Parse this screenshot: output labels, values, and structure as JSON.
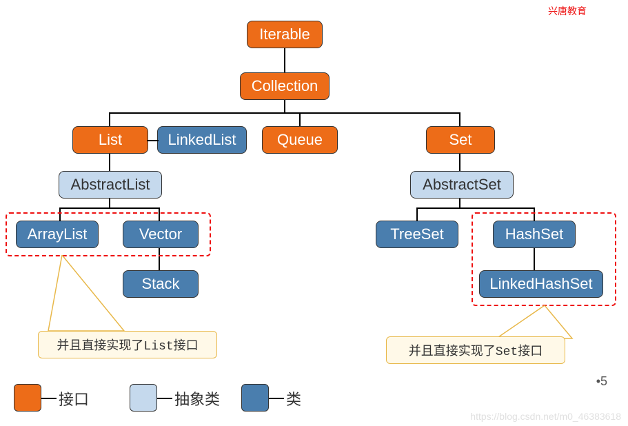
{
  "header": {
    "brand": "兴唐教育"
  },
  "nodes": {
    "iterable": "Iterable",
    "collection": "Collection",
    "list": "List",
    "linkedlist": "LinkedList",
    "queue": "Queue",
    "set": "Set",
    "abstractlist": "AbstractList",
    "abstractset": "AbstractSet",
    "arraylist": "ArrayList",
    "vector": "Vector",
    "stack": "Stack",
    "treeset": "TreeSet",
    "hashset": "HashSet",
    "linkedhashset": "LinkedHashSet"
  },
  "callouts": {
    "list_note": "并且直接实现了List接口",
    "set_note": "并且直接实现了Set接口"
  },
  "legend": {
    "interface": "接口",
    "abstract": "抽象类",
    "class": "类"
  },
  "page_number": "•5",
  "watermark": "https://blog.csdn.net/m0_46383618",
  "chart_data": {
    "type": "tree",
    "title": "Java Collection Hierarchy",
    "nodes": [
      {
        "id": "Iterable",
        "kind": "interface",
        "parent": null
      },
      {
        "id": "Collection",
        "kind": "interface",
        "parent": "Iterable"
      },
      {
        "id": "List",
        "kind": "interface",
        "parent": "Collection"
      },
      {
        "id": "Queue",
        "kind": "interface",
        "parent": "Collection"
      },
      {
        "id": "Set",
        "kind": "interface",
        "parent": "Collection"
      },
      {
        "id": "LinkedList",
        "kind": "class",
        "parent": "List"
      },
      {
        "id": "AbstractList",
        "kind": "abstract",
        "parent": "List"
      },
      {
        "id": "AbstractSet",
        "kind": "abstract",
        "parent": "Set"
      },
      {
        "id": "ArrayList",
        "kind": "class",
        "parent": "AbstractList",
        "note": "并且直接实现了List接口"
      },
      {
        "id": "Vector",
        "kind": "class",
        "parent": "AbstractList"
      },
      {
        "id": "Stack",
        "kind": "class",
        "parent": "Vector"
      },
      {
        "id": "TreeSet",
        "kind": "class",
        "parent": "AbstractSet"
      },
      {
        "id": "HashSet",
        "kind": "class",
        "parent": "AbstractSet",
        "note": "并且直接实现了Set接口"
      },
      {
        "id": "LinkedHashSet",
        "kind": "class",
        "parent": "HashSet",
        "note": "并且直接实现了Set接口"
      }
    ],
    "legend": {
      "interface": "接口",
      "abstract": "抽象类",
      "class": "类"
    },
    "highlighted_groups": [
      [
        "ArrayList",
        "Vector"
      ],
      [
        "HashSet",
        "LinkedHashSet"
      ]
    ]
  }
}
